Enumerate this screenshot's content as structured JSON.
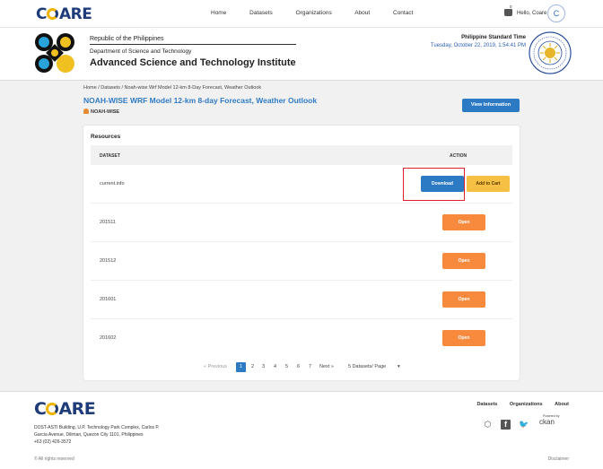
{
  "nav": {
    "logo": [
      "C",
      "ARE"
    ],
    "links": [
      "Home",
      "Datasets",
      "Organizations",
      "About",
      "Contact"
    ],
    "cart_count": "0",
    "greeting": "Hello, Coare",
    "avatar_initial": "C"
  },
  "agency": {
    "government": "Republic of the Philippines",
    "department": "Department of Science and Technology",
    "institute": "Advanced Science and Technology Institute",
    "time_label": "Philippine Standard Time",
    "time_value": "Tuesday, October 22, 2019, 1:54:41 PM"
  },
  "breadcrumb": "Home / Datasets / Noah-wise Wrf Model 12-km 8-Day Forecast, Weather Outlook",
  "dataset": {
    "title": "NOAH-WISE WRF Model 12-km 8-day Forecast, Weather Outlook",
    "organization": "NOAH-WISE",
    "view_button": "View Information"
  },
  "resources": {
    "title": "Resources",
    "col_dataset": "DATASET",
    "col_action": "ACTION",
    "rows": [
      {
        "name": "current.info",
        "download": "Download",
        "add_to_cart": "Add to Cart"
      },
      {
        "name": "201511",
        "open": "Open"
      },
      {
        "name": "201512",
        "open": "Open"
      },
      {
        "name": "201601",
        "open": "Open"
      },
      {
        "name": "201602",
        "open": "Open"
      }
    ]
  },
  "pagination": {
    "previous": "« Previous",
    "pages": [
      "1",
      "2",
      "3",
      "4",
      "5",
      "6",
      "7"
    ],
    "active_page": "1",
    "next": "Next »",
    "per_page": "5 Datasets/ Page",
    "per_page_caret": "▾"
  },
  "footer": {
    "logo": [
      "C",
      "ARE"
    ],
    "address_lines": [
      "DOST-ASTI Building, U.P. Technology Park Complex, Carlos P.",
      "Garcia Avenue, Diliman, Quezon City 1101, Philippines",
      "+63 (02) 426-3572"
    ],
    "links": [
      "Datasets",
      "Organizations",
      "About"
    ],
    "powered_by": "Powered by",
    "ckan": "ckan",
    "rights": "© All rights reserved",
    "disclaimer": "Disclaimer"
  },
  "colors": {
    "primary": "#2c7ac4",
    "open": "#f88a3e",
    "cart": "#f5c043",
    "highlight": "#e0202a"
  },
  "icons": [
    "cart-icon",
    "ckan-icon",
    "facebook-icon",
    "twitter-icon",
    "powered-by-icon"
  ]
}
